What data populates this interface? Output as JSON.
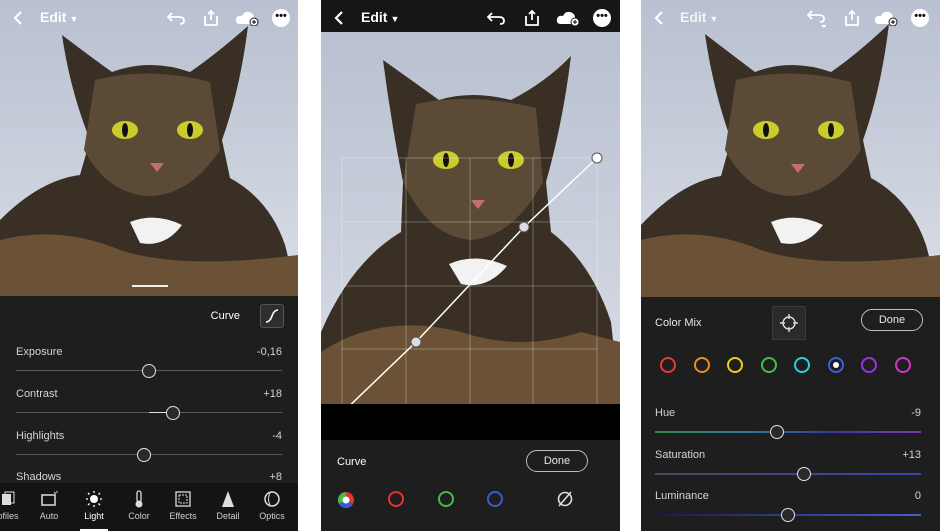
{
  "common": {
    "edit_label": "Edit",
    "more_glyph": "•••"
  },
  "panel1": {
    "curve_label": "Curve",
    "sliders": [
      {
        "label": "Exposure",
        "value": "-0,16",
        "position": 0.5
      },
      {
        "label": "Contrast",
        "value": "+18",
        "position": 0.59
      },
      {
        "label": "Highlights",
        "value": "-4",
        "position": 0.48
      },
      {
        "label": "Shadows",
        "value": "+8",
        "position": 0.54
      }
    ],
    "tabs": [
      {
        "label": "ofiles",
        "icon": "profiles-icon"
      },
      {
        "label": "Auto",
        "icon": "auto-icon"
      },
      {
        "label": "Light",
        "icon": "sun-icon",
        "active": true
      },
      {
        "label": "Color",
        "icon": "thermometer-icon"
      },
      {
        "label": "Effects",
        "icon": "effects-icon"
      },
      {
        "label": "Detail",
        "icon": "triangle-icon"
      },
      {
        "label": "Optics",
        "icon": "lens-icon"
      }
    ]
  },
  "panel2": {
    "curve_label": "Curve",
    "done_label": "Done",
    "channels": [
      {
        "name": "rgb",
        "color": "#ffffff"
      },
      {
        "name": "red",
        "color": "#e0342f"
      },
      {
        "name": "green",
        "color": "#4ab84a"
      },
      {
        "name": "blue",
        "color": "#3a5bd0"
      }
    ]
  },
  "panel3": {
    "color_mix_label": "Color Mix",
    "done_label": "Done",
    "swatches": [
      "#e23b3b",
      "#f08a24",
      "#e8d21a",
      "#3fbf4a",
      "#2ad0e0",
      "#3a5fe0",
      "#9b34e0",
      "#d633c8"
    ],
    "selected_swatch": 5,
    "sliders": [
      {
        "label": "Hue",
        "value": "-9",
        "position": 0.46
      },
      {
        "label": "Saturation",
        "value": "+13",
        "position": 0.56
      },
      {
        "label": "Luminance",
        "value": "0",
        "position": 0.5
      }
    ]
  }
}
